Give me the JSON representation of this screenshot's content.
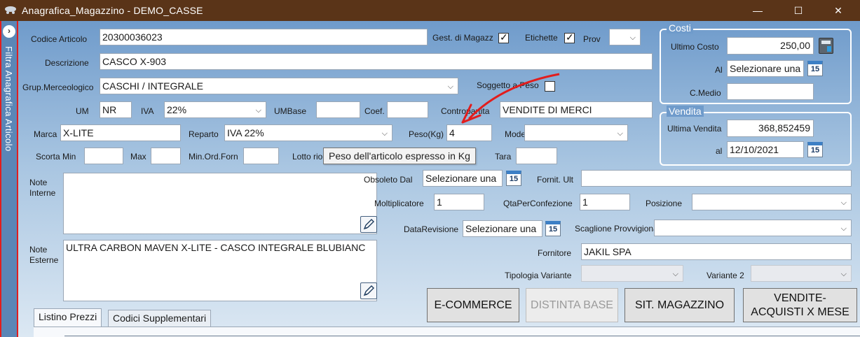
{
  "window": {
    "title": "Anagrafica_Magazzino - DEMO_CASSE",
    "minimize": "—",
    "maximize": "☐",
    "close": "✕"
  },
  "sidebar": {
    "toggle": "›",
    "label": "Filtra Anagrafica Articolo"
  },
  "fields": {
    "codice_articolo": {
      "label": "Codice Articolo",
      "value": "20300036023"
    },
    "gest_magazzino": {
      "label": "Gest. di Magazz",
      "checked": true
    },
    "etichette": {
      "label": "Etichette",
      "checked": true
    },
    "prov": {
      "label": "Prov",
      "value": ""
    },
    "descrizione": {
      "label": "Descrizione",
      "value": "CASCO X-903"
    },
    "grup_merceologico": {
      "label": "Grup.Merceologico",
      "value": "CASCHI / INTEGRALE"
    },
    "soggetto_peso": {
      "label": "Soggetto a Peso",
      "checked": false
    },
    "um": {
      "label": "UM",
      "value": "NR"
    },
    "iva": {
      "label": "IVA",
      "value": "22%"
    },
    "umbase": {
      "label": "UMBase",
      "value": ""
    },
    "coef": {
      "label": "Coef.",
      "value": ""
    },
    "contropartita": {
      "label": "Contropartita",
      "value": "VENDITE DI MERCI"
    },
    "marca": {
      "label": "Marca",
      "value": "X-LITE"
    },
    "reparto": {
      "label": "Reparto",
      "value": "IVA 22%"
    },
    "peso": {
      "label": "Peso(Kg)",
      "value": "4"
    },
    "modello": {
      "label": "Modello",
      "value": ""
    },
    "scorta_min": {
      "label": "Scorta Min",
      "value": ""
    },
    "max": {
      "label": "Max",
      "value": ""
    },
    "min_ord_forn": {
      "label": "Min.Ord.Forn",
      "value": ""
    },
    "lotto_riordino": {
      "label": "Lotto rio",
      "value": ""
    },
    "tara": {
      "label": "Tara",
      "value": ""
    },
    "note_interne": {
      "label": "Note\nInterne",
      "value": ""
    },
    "note_esterne": {
      "label": "Note\nEsterne",
      "value": "ULTRA CARBON MAVEN X-LITE - CASCO INTEGRALE BLUBIANC"
    },
    "obsoleto_dal": {
      "label": "Obsoleto Dal",
      "value": "Selezionare una"
    },
    "fornit_ult": {
      "label": "Fornit. Ult",
      "value": ""
    },
    "moltiplicatore": {
      "label": "Moltiplicatore",
      "value": "1"
    },
    "qta_per_confezione": {
      "label": "QtaPerConfezione",
      "value": "1"
    },
    "posizione": {
      "label": "Posizione",
      "value": ""
    },
    "data_revisione": {
      "label": "DataRevisione",
      "value": "Selezionare una"
    },
    "scaglione_provvigionale": {
      "label": "Scaglione Provvigionale",
      "value": ""
    },
    "fornitore": {
      "label": "Fornitore",
      "value": "JAKIL SPA"
    },
    "tipologia_variante": {
      "label": "Tipologia Variante",
      "value": ""
    },
    "variante2": {
      "label": "Variante 2",
      "value": ""
    }
  },
  "costi": {
    "title": "Costi",
    "ultimo_costo_label": "Ultimo Costo",
    "ultimo_costo": "250,00",
    "al_label": "Al",
    "al_value": "Selezionare una",
    "cmedio_label": "C.Medio",
    "cmedio_value": ""
  },
  "vendita": {
    "title": "Vendita",
    "ultima_vendita_label": "Ultima Vendita",
    "ultima_vendita": "368,852459",
    "al_label": "al",
    "al_value": "12/10/2021"
  },
  "calendar_icon": "15",
  "tooltip": "Peso dell'articolo espresso in Kg",
  "buttons": {
    "ecommerce": "E-COMMERCE",
    "distinta_base": "DISTINTA BASE",
    "sit_magazzino": "SIT. MAGAZZINO",
    "vendite_acquisti": "VENDITE-ACQUISTI X MESE"
  },
  "tabs": [
    "Listino Prezzi",
    "Codici Supplementari"
  ],
  "colors": {
    "titlebar": "#5a3418",
    "sidebar": "#5b86b6",
    "highlight": "#e21d1d"
  }
}
